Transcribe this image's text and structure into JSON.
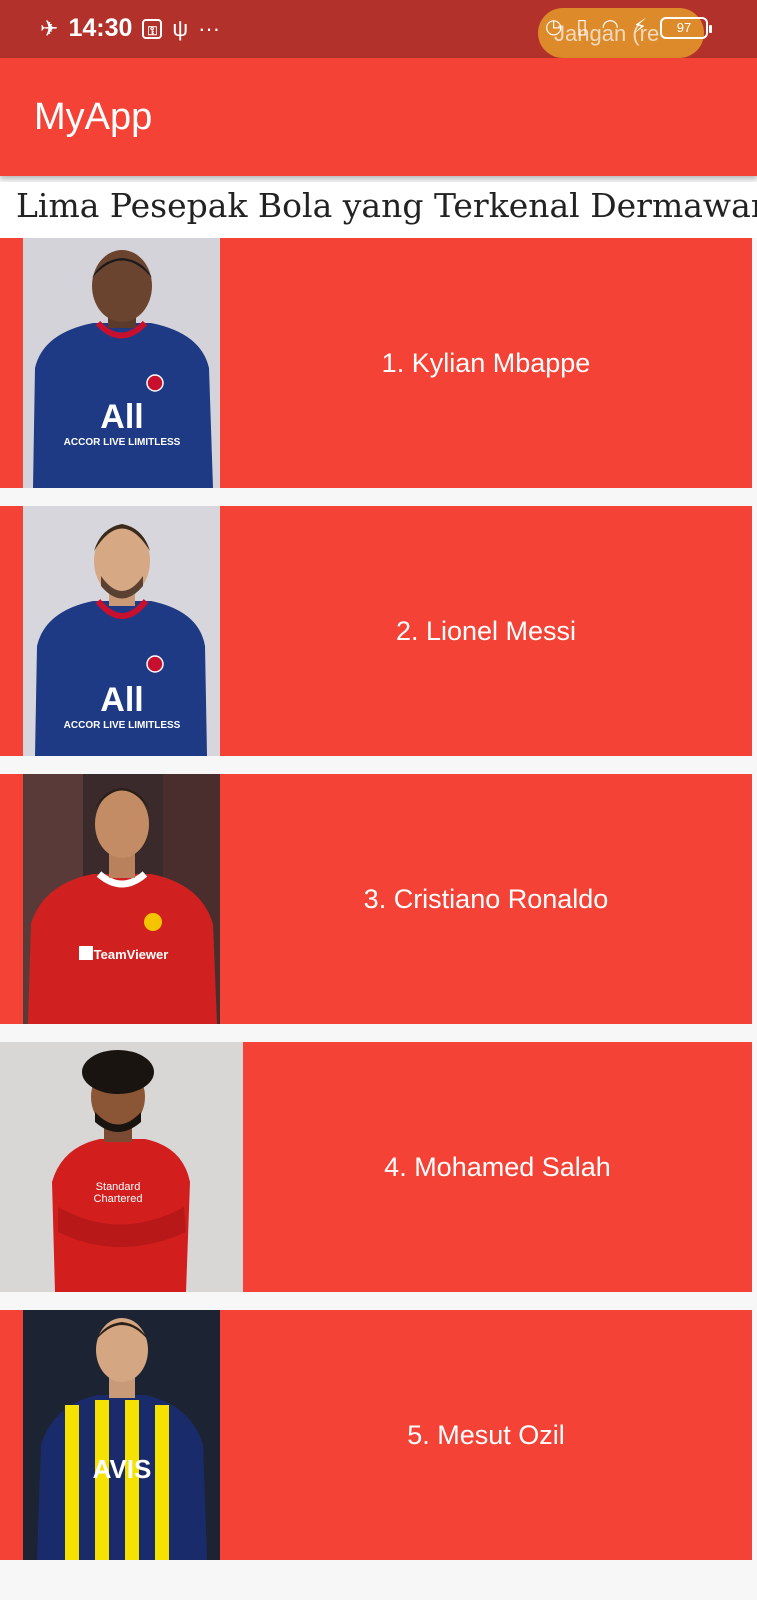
{
  "status_bar": {
    "time": "14:30",
    "notification_text": "Jangan (re",
    "battery": "97",
    "icons": [
      "airplane-icon",
      "vpn-icon",
      "usb-icon",
      "more-icon",
      "alarm-icon",
      "vibrate-icon",
      "wifi-icon",
      "charging-icon",
      "battery-icon"
    ]
  },
  "app_bar": {
    "title": "MyApp"
  },
  "heading": "Lima Pesepak Bola yang Terkenal Dermawan",
  "players": [
    {
      "label": "1. Kylian Mbappe",
      "kit_color": "#1e3a84",
      "trim": "#c8102e",
      "sponsor": "ALL"
    },
    {
      "label": "2. Lionel Messi",
      "kit_color": "#1e3a84",
      "trim": "#c8102e",
      "sponsor": "ALL"
    },
    {
      "label": "3. Cristiano Ronaldo",
      "kit_color": "#d0201f",
      "trim": "#ffffff",
      "sponsor": "TeamViewer"
    },
    {
      "label": "4. Mohamed Salah",
      "kit_color": "#d31e1e",
      "trim": "#ffffff",
      "sponsor": "Standard Chartered"
    },
    {
      "label": "5. Mesut Ozil",
      "kit_color": "#1a2b6b",
      "trim": "#f5e200",
      "sponsor": "AVIS"
    }
  ],
  "colors": {
    "primary": "#f44336",
    "status_bar": "#b3312b",
    "background": "#f7f7f8"
  }
}
